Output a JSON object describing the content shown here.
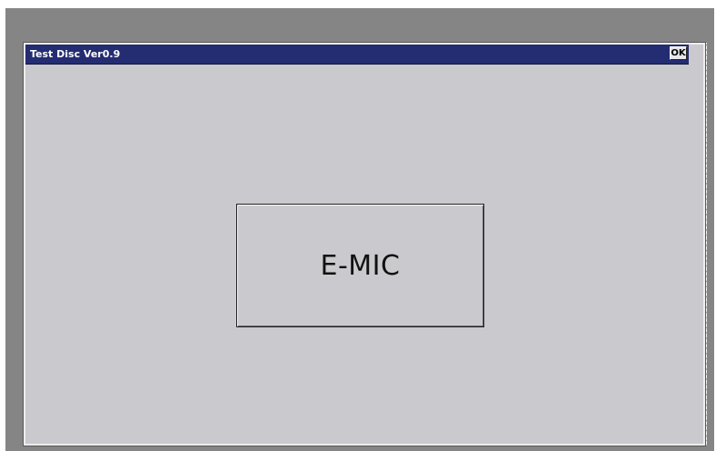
{
  "window": {
    "title": "Test Disc Ver0.9",
    "ok_label": "OK"
  },
  "main": {
    "test_button_label": "E-MIC"
  },
  "colors": {
    "titlebar": "#242c72",
    "window_background": "#c5c4c8",
    "screen_background": "#858585"
  }
}
